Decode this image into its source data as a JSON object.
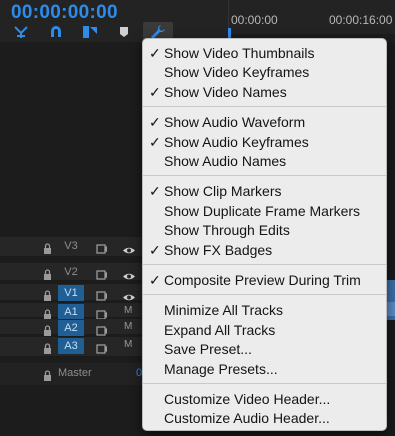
{
  "timecode": "00:00:00:00",
  "ruler": {
    "labels": [
      "00:00:00",
      "00:00:16:00"
    ]
  },
  "tracks": [
    {
      "name": "V3",
      "kind": "video",
      "active": false
    },
    {
      "name": "V2",
      "kind": "video",
      "active": false
    },
    {
      "name": "V1",
      "kind": "video",
      "active": true
    },
    {
      "name": "A1",
      "kind": "audio",
      "active": true,
      "mute": "M"
    },
    {
      "name": "A2",
      "kind": "audio",
      "active": true,
      "mute": "M"
    },
    {
      "name": "A3",
      "kind": "audio",
      "active": true,
      "mute": "M"
    }
  ],
  "master": {
    "label": "Master",
    "value": "0"
  },
  "menu": {
    "groups": [
      [
        {
          "label": "Show Video Thumbnails",
          "checked": true
        },
        {
          "label": "Show Video Keyframes",
          "checked": false
        },
        {
          "label": "Show Video Names",
          "checked": true
        }
      ],
      [
        {
          "label": "Show Audio Waveform",
          "checked": true
        },
        {
          "label": "Show Audio Keyframes",
          "checked": true
        },
        {
          "label": "Show Audio Names",
          "checked": false
        }
      ],
      [
        {
          "label": "Show Clip Markers",
          "checked": true
        },
        {
          "label": "Show Duplicate Frame Markers",
          "checked": false
        },
        {
          "label": "Show Through Edits",
          "checked": false
        },
        {
          "label": "Show FX Badges",
          "checked": true
        }
      ],
      [
        {
          "label": "Composite Preview During Trim",
          "checked": true
        }
      ],
      [
        {
          "label": "Minimize All Tracks",
          "checked": false
        },
        {
          "label": "Expand All Tracks",
          "checked": false
        },
        {
          "label": "Save Preset...",
          "checked": false
        },
        {
          "label": "Manage Presets...",
          "checked": false
        }
      ],
      [
        {
          "label": "Customize Video Header...",
          "checked": false
        },
        {
          "label": "Customize Audio Header...",
          "checked": false
        }
      ]
    ],
    "check_glyph": "✓"
  },
  "colors": {
    "accent": "#2d8ceb",
    "track_active": "#1f5f95",
    "menu_bg": "#ececec"
  }
}
